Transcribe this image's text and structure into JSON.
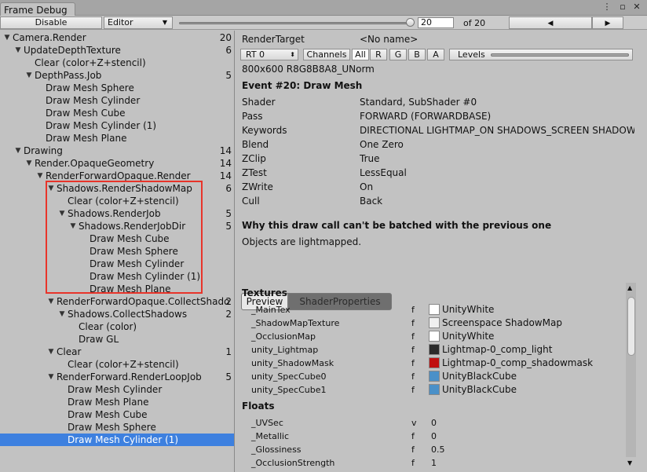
{
  "window": {
    "tab_title": "Frame Debug",
    "menu_icon": "menu-icon",
    "maximize_icon": "maximize-icon",
    "close_icon": "close-icon"
  },
  "toolbar": {
    "disable_label": "Disable",
    "editor_label": "Editor",
    "frame_value": "20",
    "frame_total_label": "of 20",
    "prev_label": "◀",
    "next_label": "▶",
    "slider_fraction": 1.0
  },
  "tree": [
    {
      "label": "Camera.Render",
      "count": "20",
      "depth": 0,
      "expander": "▼"
    },
    {
      "label": "UpdateDepthTexture",
      "count": "6",
      "depth": 1,
      "expander": "▼"
    },
    {
      "label": "Clear (color+Z+stencil)",
      "count": "",
      "depth": 2,
      "expander": ""
    },
    {
      "label": "DepthPass.Job",
      "count": "5",
      "depth": 2,
      "expander": "▼"
    },
    {
      "label": "Draw Mesh Sphere",
      "count": "",
      "depth": 3,
      "expander": ""
    },
    {
      "label": "Draw Mesh Cylinder",
      "count": "",
      "depth": 3,
      "expander": ""
    },
    {
      "label": "Draw Mesh Cube",
      "count": "",
      "depth": 3,
      "expander": ""
    },
    {
      "label": "Draw Mesh Cylinder (1)",
      "count": "",
      "depth": 3,
      "expander": ""
    },
    {
      "label": "Draw Mesh Plane",
      "count": "",
      "depth": 3,
      "expander": ""
    },
    {
      "label": "Drawing",
      "count": "14",
      "depth": 1,
      "expander": "▼"
    },
    {
      "label": "Render.OpaqueGeometry",
      "count": "14",
      "depth": 2,
      "expander": "▼"
    },
    {
      "label": "RenderForwardOpaque.Render",
      "count": "14",
      "depth": 3,
      "expander": "▼"
    },
    {
      "label": "Shadows.RenderShadowMap",
      "count": "6",
      "depth": 4,
      "expander": "▼"
    },
    {
      "label": "Clear (color+Z+stencil)",
      "count": "",
      "depth": 5,
      "expander": ""
    },
    {
      "label": "Shadows.RenderJob",
      "count": "5",
      "depth": 5,
      "expander": "▼"
    },
    {
      "label": "Shadows.RenderJobDir",
      "count": "5",
      "depth": 6,
      "expander": "▼"
    },
    {
      "label": "Draw Mesh Cube",
      "count": "",
      "depth": 7,
      "expander": ""
    },
    {
      "label": "Draw Mesh Sphere",
      "count": "",
      "depth": 7,
      "expander": ""
    },
    {
      "label": "Draw Mesh Cylinder",
      "count": "",
      "depth": 7,
      "expander": ""
    },
    {
      "label": "Draw Mesh Cylinder (1)",
      "count": "",
      "depth": 7,
      "expander": ""
    },
    {
      "label": "Draw Mesh Plane",
      "count": "",
      "depth": 7,
      "expander": ""
    },
    {
      "label": "RenderForwardOpaque.CollectShado",
      "count": "2",
      "depth": 4,
      "expander": "▼"
    },
    {
      "label": "Shadows.CollectShadows",
      "count": "2",
      "depth": 5,
      "expander": "▼"
    },
    {
      "label": "Clear (color)",
      "count": "",
      "depth": 6,
      "expander": ""
    },
    {
      "label": "Draw GL",
      "count": "",
      "depth": 6,
      "expander": ""
    },
    {
      "label": "Clear",
      "count": "1",
      "depth": 4,
      "expander": "▼"
    },
    {
      "label": "Clear (color+Z+stencil)",
      "count": "",
      "depth": 5,
      "expander": ""
    },
    {
      "label": "RenderForward.RenderLoopJob",
      "count": "5",
      "depth": 4,
      "expander": "▼"
    },
    {
      "label": "Draw Mesh Cylinder",
      "count": "",
      "depth": 5,
      "expander": ""
    },
    {
      "label": "Draw Mesh Plane",
      "count": "",
      "depth": 5,
      "expander": ""
    },
    {
      "label": "Draw Mesh Cube",
      "count": "",
      "depth": 5,
      "expander": ""
    },
    {
      "label": "Draw Mesh Sphere",
      "count": "",
      "depth": 5,
      "expander": ""
    },
    {
      "label": "Draw Mesh Cylinder (1)",
      "count": "",
      "depth": 5,
      "expander": "",
      "selected": true
    }
  ],
  "detail": {
    "render_target_label": "RenderTarget",
    "render_target_value": "<No name>",
    "rt_select": "RT 0",
    "channels_label": "Channels",
    "channel_all": "All",
    "channel_r": "R",
    "channel_g": "G",
    "channel_b": "B",
    "channel_a": "A",
    "levels_label": "Levels",
    "format_text": "800x600 R8G8B8A8_UNorm",
    "event_title": "Event #20: Draw Mesh",
    "fields": [
      {
        "key": "Shader",
        "value": "Standard, SubShader #0"
      },
      {
        "key": "Pass",
        "value": "FORWARD (FORWARDBASE)"
      },
      {
        "key": "Keywords",
        "value": "DIRECTIONAL LIGHTMAP_ON SHADOWS_SCREEN SHADOWS"
      },
      {
        "key": "Blend",
        "value": "One Zero"
      },
      {
        "key": "ZClip",
        "value": "True"
      },
      {
        "key": "ZTest",
        "value": "LessEqual"
      },
      {
        "key": "ZWrite",
        "value": "On"
      },
      {
        "key": "Cull",
        "value": "Back"
      }
    ],
    "batch_heading": "Why this draw call can't be batched with the previous one",
    "batch_reason": "Objects are lightmapped.",
    "tab_preview": "Preview",
    "tab_shader_properties": "ShaderProperties",
    "textures_heading": "Textures",
    "textures": [
      {
        "name": "_MainTex",
        "type": "f",
        "value": "UnityWhite",
        "swatch": "#ffffff"
      },
      {
        "name": "_ShadowMapTexture",
        "type": "f",
        "value": "Screenspace ShadowMap",
        "swatch": "#f0f0f0"
      },
      {
        "name": "_OcclusionMap",
        "type": "f",
        "value": "UnityWhite",
        "swatch": "#ffffff"
      },
      {
        "name": "unity_Lightmap",
        "type": "f",
        "value": "Lightmap-0_comp_light",
        "swatch": "#2a2a2a"
      },
      {
        "name": "unity_ShadowMask",
        "type": "f",
        "value": "Lightmap-0_comp_shadowmask",
        "swatch": "#c01010"
      },
      {
        "name": "unity_SpecCube0",
        "type": "f",
        "value": "UnityBlackCube",
        "swatch": "#4a90c8"
      },
      {
        "name": "unity_SpecCube1",
        "type": "f",
        "value": "UnityBlackCube",
        "swatch": "#4a90c8"
      }
    ],
    "floats_heading": "Floats",
    "floats": [
      {
        "name": "_UVSec",
        "type": "v",
        "value": "0"
      },
      {
        "name": "_Metallic",
        "type": "f",
        "value": "0"
      },
      {
        "name": "_Glossiness",
        "type": "f",
        "value": "0.5"
      },
      {
        "name": "_OcclusionStrength",
        "type": "f",
        "value": "1"
      }
    ]
  },
  "colors": {
    "selection": "#3d80df",
    "highlight_box": "#e8342a",
    "panel_bg": "#c2c2c2"
  }
}
